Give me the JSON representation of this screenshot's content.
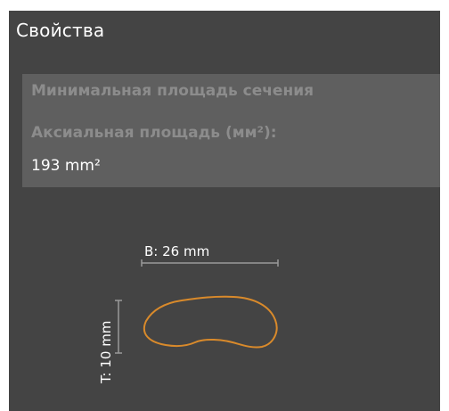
{
  "panel": {
    "title": "Свойства"
  },
  "properties": {
    "section_title": "Минимальная площадь сечения",
    "axial_area_label": "Аксиальная площадь (мм²):",
    "axial_area_value": "193 mm²"
  },
  "cross_section": {
    "width_label": "B: 26 mm",
    "thickness_label": "T: 10 mm",
    "outline_color": "#d98a2b",
    "dimension_line_color": "#9a9a9a"
  }
}
